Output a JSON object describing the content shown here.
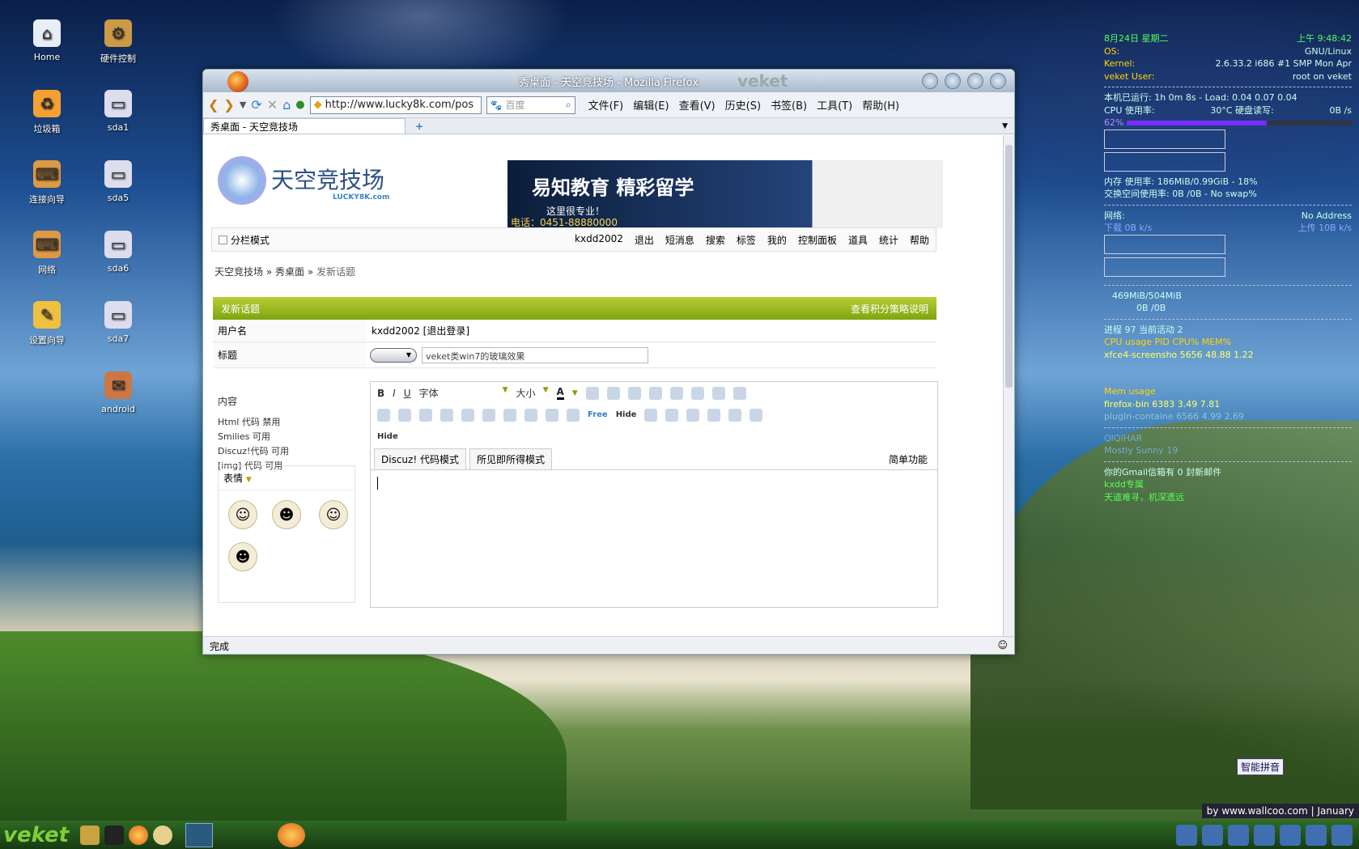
{
  "desktop": {
    "icons": [
      {
        "label": "Home",
        "glyph": "⌂"
      },
      {
        "label": "硬件控制",
        "glyph": "⚙"
      },
      {
        "label": "垃圾箱",
        "glyph": "♻"
      },
      {
        "label": "sda1",
        "glyph": "▭"
      },
      {
        "label": "连接向导",
        "glyph": "⌨"
      },
      {
        "label": "sda5",
        "glyph": "▭"
      },
      {
        "label": "网络",
        "glyph": "⌨"
      },
      {
        "label": "sda6",
        "glyph": "▭"
      },
      {
        "label": "设置向导",
        "glyph": "✎"
      },
      {
        "label": "sda7",
        "glyph": "▭"
      },
      {
        "label": "android",
        "glyph": "✉"
      }
    ]
  },
  "window": {
    "title": "秀桌面 - 天空竞技场 - Mozilla Firefox",
    "brand": "veket"
  },
  "nav": {
    "url": "http://www.lucky8k.com/pos",
    "search_placeholder": "百度",
    "menus": [
      "文件(F)",
      "编辑(E)",
      "查看(V)",
      "历史(S)",
      "书签(B)",
      "工具(T)",
      "帮助(H)"
    ]
  },
  "tab": {
    "title": "秀桌面 - 天空竞技场",
    "new_tab": "+"
  },
  "site": {
    "logo": "天空竞技场",
    "logo_sub": "LUCKY8K.com",
    "banner": {
      "headline": "易知教育 精彩留学",
      "slogan": "这里很专业！",
      "phone": "电话：0451-88880000"
    },
    "split_mode": "分栏模式",
    "userbar": [
      "kxdd2002",
      "退出",
      "短消息",
      "搜索",
      "标签",
      "我的",
      "控制面板",
      "道具",
      "统计",
      "帮助"
    ],
    "breadcrumb": [
      "天空竞技场",
      "秀桌面",
      "发新话题"
    ],
    "form": {
      "title": "发新话题",
      "rules_link": "查看积分策略说明",
      "username_label": "用户名",
      "username": "kxdd2002 [退出登录]",
      "subject_label": "标题",
      "subject": "veket类win7的玻璃效果",
      "content_label": "内容",
      "hints": [
        "Html 代码 禁用",
        "Smilies 可用",
        "Discuz!代码 可用",
        "[img] 代码 可用"
      ],
      "smilies_label": "表情",
      "font_label": "字体",
      "size_label": "大小",
      "mode_discuz": "Discuz! 代码模式",
      "mode_wysiwyg": "所见即所得模式",
      "simple": "简单功能",
      "toolbar_free": "Free",
      "toolbar_hide": "Hide"
    }
  },
  "status": {
    "text": "完成"
  },
  "conky": {
    "date": "8月24日 星期二",
    "time": "上午 9:48:42",
    "os_label": "OS:",
    "os": "GNU/Linux",
    "kernel_label": "Kernel:",
    "kernel": "2.6.33.2 i686 #1 SMP Mon Apr",
    "user_label": "veket User:",
    "user": "root on veket",
    "uptime": "本机已运行: 1h 0m 8s - Load: 0.04 0.07 0.04",
    "cpu_label": "CPU 使用率:",
    "cpu_temp": "30°C 硬盘读写:",
    "disk": "0B /s",
    "cpu_pct": "62%",
    "cpu_fill": 0.62,
    "mem": "内存 使用率: 186MiB/0.99GiB - 18%",
    "mem_fill": 0.18,
    "swap": "交换空间使用率: 0B /0B - No swap%",
    "net_label": "网络:",
    "net": "No Address",
    "down": "下载 0B k/s",
    "up": "上传 10B k/s",
    "disk_usage": "469MiB/504MiB",
    "disk_usage_fill": 0.93,
    "disk2": "0B /0B",
    "procs": "进程 97 当前活动 2",
    "proc_head": "CPU usage PID CPU% MEM%",
    "proc1": "xfce4-screensho 5656 48.88 1.22",
    "mem_head": "Mem usage",
    "mem1": "firefox-bin 6383 3.49 7.81",
    "mem3": "plugin-containe 6566 4.99 2.69",
    "weather_city": "QIQIHAR",
    "weather": "Mostly Sunny 19",
    "gmail": "你的Gmail信箱有 0 封新邮件",
    "line1": "kxdd专属",
    "line2": "天道难寻，机深遗远"
  },
  "taskbar": {
    "brand": "veket"
  },
  "ime": "智能拼音",
  "credit": "by www.wallcoo.com | January"
}
